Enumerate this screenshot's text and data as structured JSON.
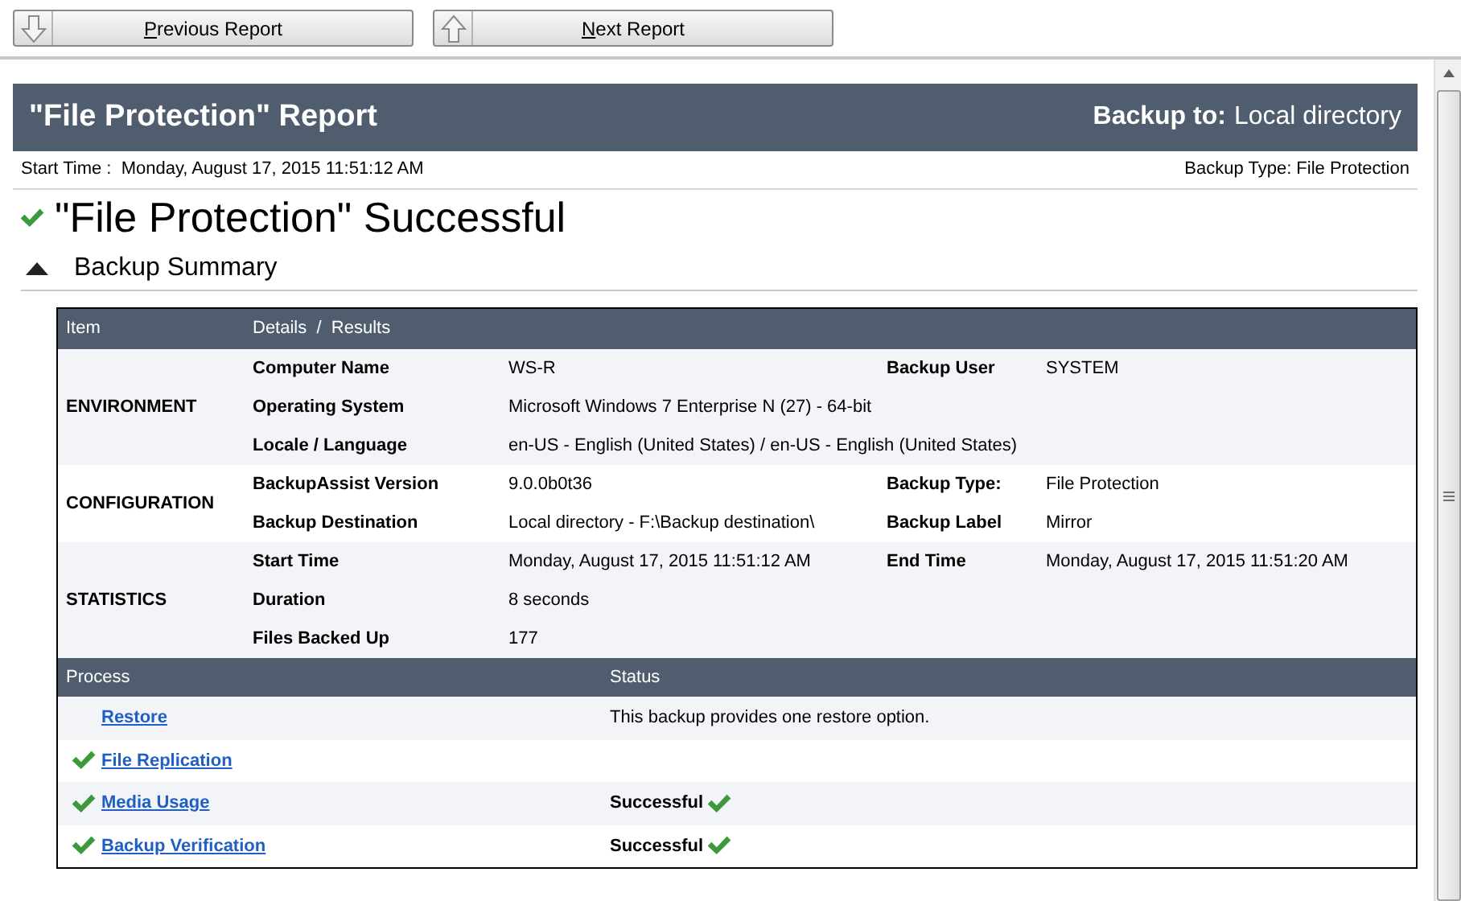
{
  "toolbar": {
    "buttons": [
      {
        "label": "Previous Report",
        "kind": "down"
      },
      {
        "label": "Next Report",
        "kind": "up"
      }
    ]
  },
  "report": {
    "title": "\"File Protection\" Report",
    "backup_to_label": "Backup to:",
    "backup_to_value": "Local directory",
    "start_time": "Start Time :  Monday, August 17, 2015 11:51:12 AM",
    "backup_type": "Backup Type: File Protection",
    "result": "\"File Protection\" Successful",
    "result_ok": true
  },
  "summary": {
    "heading": "Backup Summary",
    "expanded": true,
    "columns": [
      "Item",
      "Details  /  Results"
    ],
    "sections": [
      {
        "name": "ENVIRONMENT",
        "rows": [
          {
            "label": "Computer Name",
            "value": "WS-R",
            "label2": "Backup User",
            "value2": "SYSTEM"
          },
          {
            "label": "Operating System",
            "value": "Microsoft Windows 7 Enterprise N (27) - 64-bit"
          },
          {
            "label": "Locale / Language",
            "value": "en-US - English (United States) / en-US - English (United States)"
          }
        ]
      },
      {
        "name": "CONFIGURATION",
        "rows": [
          {
            "label": "BackupAssist Version",
            "value": "9.0.0b0t36",
            "label2": "Backup Type:",
            "value2": "File Protection"
          },
          {
            "label": "Backup Destination",
            "value": "Local directory - F:\\Backup destination\\",
            "label2": "Backup Label",
            "value2": "Mirror"
          }
        ]
      },
      {
        "name": "STATISTICS",
        "rows": [
          {
            "label": "Start Time",
            "value": "Monday, August 17, 2015 11:51:12 AM",
            "label2": "End Time",
            "value2": "Monday, August 17, 2015 11:51:20 AM"
          },
          {
            "label": "Duration",
            "value": "8 seconds"
          },
          {
            "label": "Files Backed Up",
            "value": "177"
          }
        ]
      }
    ],
    "process_columns": [
      "Process",
      "Status"
    ],
    "processes": [
      {
        "name": "Restore",
        "ok": false,
        "status": "This backup provides one restore option.",
        "kind": "note"
      },
      {
        "name": "File Replication",
        "ok": true
      },
      {
        "name": "Media Usage",
        "ok": true,
        "status": "Successful",
        "kind": "success"
      },
      {
        "name": "Backup Verification",
        "ok": true,
        "status": "Successful",
        "kind": "success"
      }
    ]
  }
}
